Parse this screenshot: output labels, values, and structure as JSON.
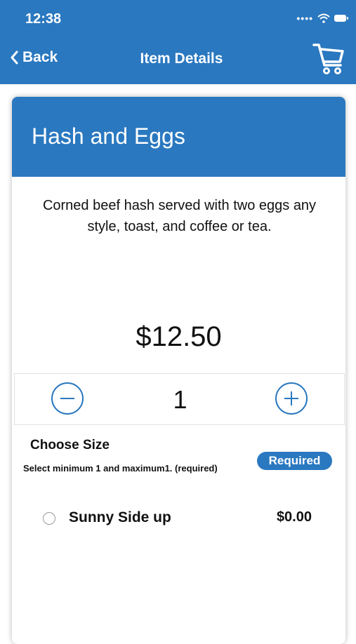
{
  "status_bar": {
    "time": "12:38",
    "signal_dots": "••••"
  },
  "nav": {
    "back_label": "Back",
    "title": "Item Details"
  },
  "item": {
    "name": "Hash and Eggs",
    "description": "Corned beef hash served with two eggs any style, toast, and coffee or tea.",
    "price": "$12.50",
    "quantity": "1"
  },
  "options_section": {
    "title": "Choose Size",
    "rule": "Select minimum 1 and maximum1. (required)",
    "badge": "Required",
    "options": [
      {
        "label": "Sunny Side up",
        "price": "$0.00",
        "selected": false
      }
    ]
  },
  "colors": {
    "brand_blue": "#2a78c0",
    "background": "#ffffff",
    "text": "#111111"
  }
}
